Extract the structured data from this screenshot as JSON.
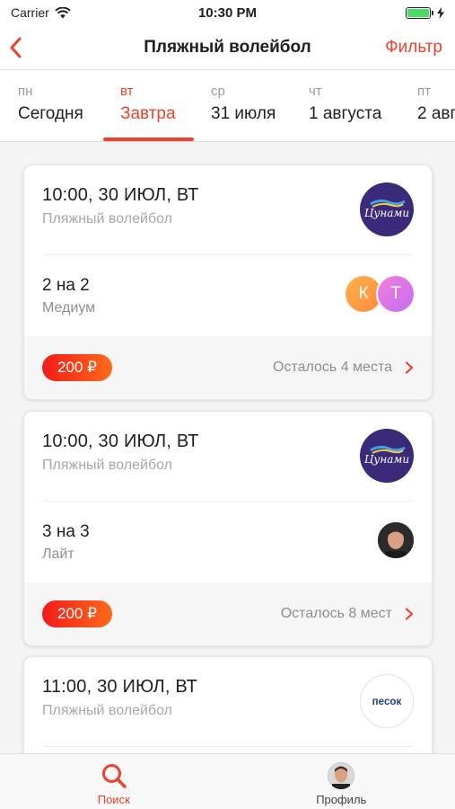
{
  "status_bar": {
    "carrier": "Carrier",
    "time": "10:30 PM",
    "battery_level": 1.0
  },
  "nav": {
    "title": "Пляжный волейбол",
    "filter_label": "Фильтр"
  },
  "days": [
    {
      "short": "пн",
      "label": "Сегодня",
      "active": false
    },
    {
      "short": "вт",
      "label": "Завтра",
      "active": true
    },
    {
      "short": "ср",
      "label": "31 июля",
      "active": false
    },
    {
      "short": "чт",
      "label": "1 августа",
      "active": false
    },
    {
      "short": "пт",
      "label": "2 авг",
      "active": false
    }
  ],
  "cards": [
    {
      "time": "10:00, 30 ИЮЛ, ВТ",
      "sport": "Пляжный волейбол",
      "logo_text": "Цунами",
      "format": "2 на 2",
      "level": "Медиум",
      "players": [
        "К",
        "Т"
      ],
      "price": "200 ₽",
      "seats": "Осталось 4 места"
    },
    {
      "time": "10:00, 30 ИЮЛ, ВТ",
      "sport": "Пляжный волейбол",
      "logo_text": "Цунами",
      "format": "3 на 3",
      "level": "Лайт",
      "price": "200 ₽",
      "seats": "Осталось 8 мест"
    },
    {
      "time": "11:00, 30 ИЮЛ, ВТ",
      "sport": "Пляжный волейбол",
      "logo_text": "песок"
    }
  ],
  "tab_bar": {
    "search_label": "Поиск",
    "profile_label": "Профиль"
  },
  "colors": {
    "accent": "#f0412c",
    "brand_cunami": "#3b2a7a"
  }
}
